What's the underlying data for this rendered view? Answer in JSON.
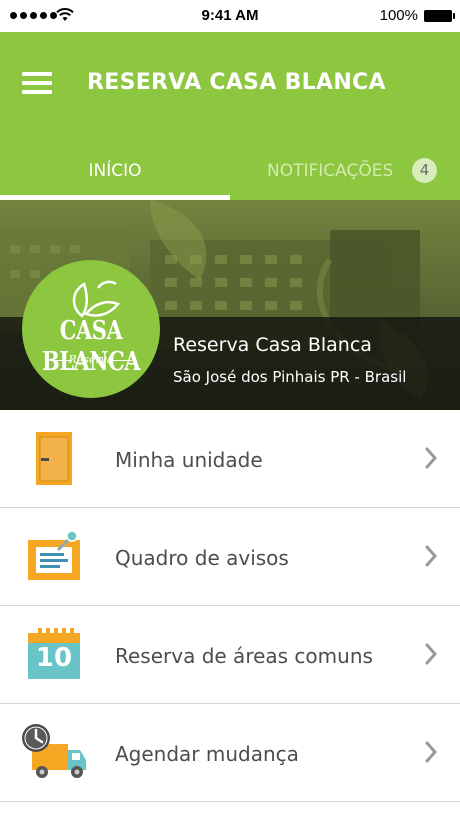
{
  "status_bar": {
    "time": "9:41 AM",
    "battery_percent": "100%",
    "signal_icon": "signal-dots-icon",
    "wifi_icon": "wifi-icon",
    "battery_icon": "battery-icon"
  },
  "header": {
    "title": "RESERVA CASA BLANCA",
    "menu_icon": "hamburger-menu-icon",
    "background_color": "#8dc63f"
  },
  "tabs": [
    {
      "label": "INÍCIO",
      "active": true
    },
    {
      "label": "NOTIFICAÇÕES",
      "badge": "4",
      "active": false
    }
  ],
  "hero": {
    "logo_text": "CASA BLANCA",
    "logo_subtext": "Reserva",
    "name": "Reserva Casa Blanca",
    "location": "São José dos Pinhais PR - Brasil"
  },
  "menu": [
    {
      "label": "Minha unidade",
      "icon": "door-icon"
    },
    {
      "label": "Quadro de avisos",
      "icon": "notice-board-icon"
    },
    {
      "label": "Reserva de áreas comuns",
      "icon": "calendar-icon",
      "icon_text": "10"
    },
    {
      "label": "Agendar mudança",
      "icon": "moving-truck-icon"
    }
  ],
  "colors": {
    "accent": "#8dc63f",
    "door": "#f5a623",
    "calendar": "#68c4c7",
    "text": "#4d4d4d"
  }
}
